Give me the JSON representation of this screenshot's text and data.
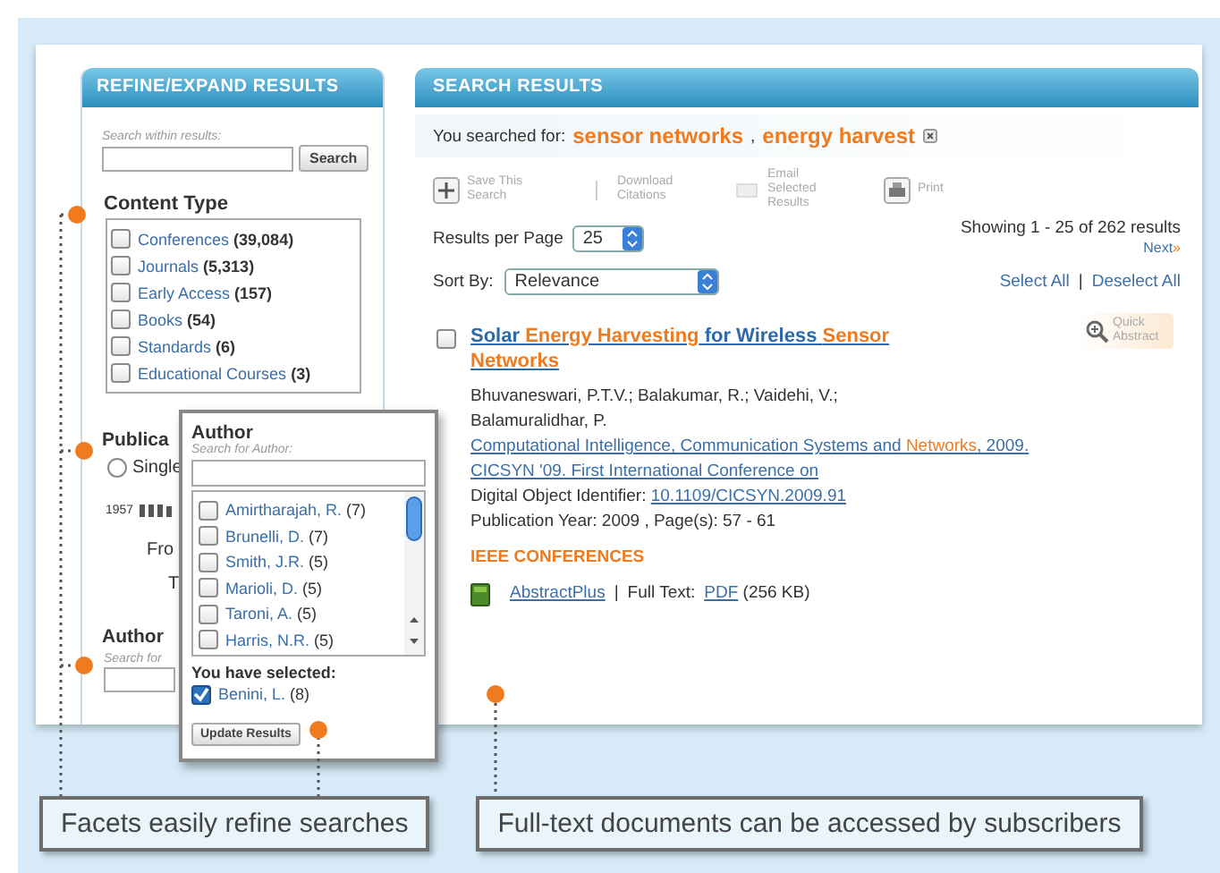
{
  "sidebar": {
    "title": "REFINE/EXPAND RESULTS",
    "search_label": "Search within results:",
    "search_button": "Search",
    "content_type": {
      "heading": "Content Type",
      "items": [
        {
          "label": "Conferences",
          "count": "(39,084)",
          "checked": false
        },
        {
          "label": "Journals",
          "count": "(5,313)",
          "checked": false
        },
        {
          "label": "Early Access",
          "count": "(157)",
          "checked": false
        },
        {
          "label": "Books",
          "count": "(54)",
          "checked": false
        },
        {
          "label": "Standards",
          "count": "(6)",
          "checked": false
        },
        {
          "label": "Educational Courses",
          "count": "(3)",
          "checked": false
        }
      ]
    },
    "publication": {
      "heading": "Publica",
      "option": "Single",
      "selected": false,
      "year": "1957",
      "from": "Fro",
      "to": "T"
    },
    "author": {
      "heading": "Author",
      "placeholder": "Search for"
    }
  },
  "author_popup": {
    "title": "Author",
    "search_label": "Search for Author:",
    "items": [
      {
        "label": "Amirtharajah, R.",
        "count": "(7)",
        "checked": false
      },
      {
        "label": "Brunelli, D.",
        "count": "(7)",
        "checked": false
      },
      {
        "label": "Smith, J.R.",
        "count": "(5)",
        "checked": false
      },
      {
        "label": "Marioli, D.",
        "count": "(5)",
        "checked": false
      },
      {
        "label": "Taroni, A.",
        "count": "(5)",
        "checked": false
      },
      {
        "label": "Harris, N.R.",
        "count": "(5)",
        "checked": false
      }
    ],
    "selected_heading": "You have selected:",
    "selected_items": [
      {
        "label": "Benini, L.",
        "count": "(8)",
        "checked": true
      }
    ],
    "button": "Update Results"
  },
  "results": {
    "title": "SEARCH RESULTS",
    "searched_label": "You searched for:",
    "terms": [
      "sensor networks",
      "energy harvest"
    ],
    "separator": ",",
    "toolbar": [
      {
        "kind": "save",
        "label": "Save This Search"
      },
      {
        "kind": "download",
        "label": "Download Citations"
      },
      {
        "kind": "email",
        "label": "Email Selected Results"
      },
      {
        "kind": "print",
        "label": "Print"
      }
    ],
    "per_page_label": "Results per Page",
    "per_page": "25",
    "showing": "Showing 1 - 25 of 262 results",
    "next": "Next",
    "next_mark": "»",
    "sort_label": "Sort By:",
    "sort_value": "Relevance",
    "select_all": "Select All",
    "link_separator": "|",
    "deselect_all": "Deselect All",
    "result": {
      "checked": false,
      "title": [
        {
          "text": "Solar ",
          "highlight": false
        },
        {
          "text": "Energy Harvesting",
          "highlight": true
        },
        {
          "text": " for Wireless ",
          "highlight": false
        },
        {
          "text": "Sensor Networks",
          "highlight": true
        }
      ],
      "quick_abstract": "Quick Abstract",
      "authors": "Bhuvaneswari, P.T.V.; Balakumar, R.; Vaidehi, V.; Balamuralidhar, P.",
      "publication": [
        {
          "text": "Computational Intelligence, Communication Systems and ",
          "highlight": false
        },
        {
          "text": "Networks",
          "highlight": true
        },
        {
          "text": ", 2009. CICSYN '09. First International Conference on",
          "highlight": false
        }
      ],
      "doi_label": "Digital Object Identifier:",
      "doi": "10.1109/CICSYN.2009.91",
      "year_pages": "Publication Year: 2009 , Page(s): 57 - 61",
      "source": "IEEE CONFERENCES",
      "abstract_link": "AbstractPlus",
      "separator": "|",
      "full_text_label": "Full Text:",
      "pdf": "PDF",
      "size": "(256 KB)"
    }
  },
  "callouts": [
    "Facets easily refine searches",
    "Full-text documents can be accessed by subscribers"
  ]
}
